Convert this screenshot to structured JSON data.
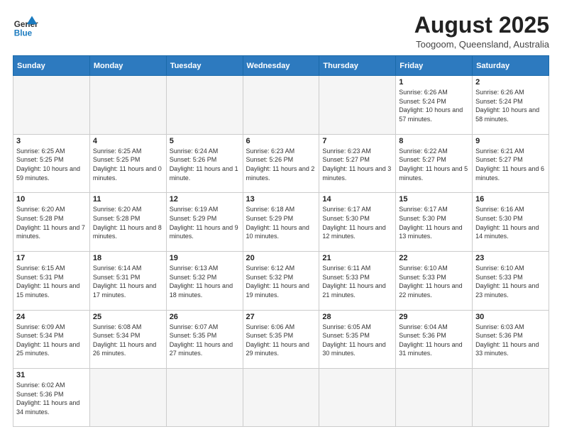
{
  "header": {
    "logo_general": "General",
    "logo_blue": "Blue",
    "month_title": "August 2025",
    "location": "Toogoom, Queensland, Australia"
  },
  "weekdays": [
    "Sunday",
    "Monday",
    "Tuesday",
    "Wednesday",
    "Thursday",
    "Friday",
    "Saturday"
  ],
  "weeks": [
    [
      {
        "day": "",
        "info": "",
        "empty": true
      },
      {
        "day": "",
        "info": "",
        "empty": true
      },
      {
        "day": "",
        "info": "",
        "empty": true
      },
      {
        "day": "",
        "info": "",
        "empty": true
      },
      {
        "day": "",
        "info": "",
        "empty": true
      },
      {
        "day": "1",
        "info": "Sunrise: 6:26 AM\nSunset: 5:24 PM\nDaylight: 10 hours\nand 57 minutes."
      },
      {
        "day": "2",
        "info": "Sunrise: 6:26 AM\nSunset: 5:24 PM\nDaylight: 10 hours\nand 58 minutes."
      }
    ],
    [
      {
        "day": "3",
        "info": "Sunrise: 6:25 AM\nSunset: 5:25 PM\nDaylight: 10 hours\nand 59 minutes."
      },
      {
        "day": "4",
        "info": "Sunrise: 6:25 AM\nSunset: 5:25 PM\nDaylight: 11 hours\nand 0 minutes."
      },
      {
        "day": "5",
        "info": "Sunrise: 6:24 AM\nSunset: 5:26 PM\nDaylight: 11 hours\nand 1 minute."
      },
      {
        "day": "6",
        "info": "Sunrise: 6:23 AM\nSunset: 5:26 PM\nDaylight: 11 hours\nand 2 minutes."
      },
      {
        "day": "7",
        "info": "Sunrise: 6:23 AM\nSunset: 5:27 PM\nDaylight: 11 hours\nand 3 minutes."
      },
      {
        "day": "8",
        "info": "Sunrise: 6:22 AM\nSunset: 5:27 PM\nDaylight: 11 hours\nand 5 minutes."
      },
      {
        "day": "9",
        "info": "Sunrise: 6:21 AM\nSunset: 5:27 PM\nDaylight: 11 hours\nand 6 minutes."
      }
    ],
    [
      {
        "day": "10",
        "info": "Sunrise: 6:20 AM\nSunset: 5:28 PM\nDaylight: 11 hours\nand 7 minutes."
      },
      {
        "day": "11",
        "info": "Sunrise: 6:20 AM\nSunset: 5:28 PM\nDaylight: 11 hours\nand 8 minutes."
      },
      {
        "day": "12",
        "info": "Sunrise: 6:19 AM\nSunset: 5:29 PM\nDaylight: 11 hours\nand 9 minutes."
      },
      {
        "day": "13",
        "info": "Sunrise: 6:18 AM\nSunset: 5:29 PM\nDaylight: 11 hours\nand 10 minutes."
      },
      {
        "day": "14",
        "info": "Sunrise: 6:17 AM\nSunset: 5:30 PM\nDaylight: 11 hours\nand 12 minutes."
      },
      {
        "day": "15",
        "info": "Sunrise: 6:17 AM\nSunset: 5:30 PM\nDaylight: 11 hours\nand 13 minutes."
      },
      {
        "day": "16",
        "info": "Sunrise: 6:16 AM\nSunset: 5:30 PM\nDaylight: 11 hours\nand 14 minutes."
      }
    ],
    [
      {
        "day": "17",
        "info": "Sunrise: 6:15 AM\nSunset: 5:31 PM\nDaylight: 11 hours\nand 15 minutes."
      },
      {
        "day": "18",
        "info": "Sunrise: 6:14 AM\nSunset: 5:31 PM\nDaylight: 11 hours\nand 17 minutes."
      },
      {
        "day": "19",
        "info": "Sunrise: 6:13 AM\nSunset: 5:32 PM\nDaylight: 11 hours\nand 18 minutes."
      },
      {
        "day": "20",
        "info": "Sunrise: 6:12 AM\nSunset: 5:32 PM\nDaylight: 11 hours\nand 19 minutes."
      },
      {
        "day": "21",
        "info": "Sunrise: 6:11 AM\nSunset: 5:33 PM\nDaylight: 11 hours\nand 21 minutes."
      },
      {
        "day": "22",
        "info": "Sunrise: 6:10 AM\nSunset: 5:33 PM\nDaylight: 11 hours\nand 22 minutes."
      },
      {
        "day": "23",
        "info": "Sunrise: 6:10 AM\nSunset: 5:33 PM\nDaylight: 11 hours\nand 23 minutes."
      }
    ],
    [
      {
        "day": "24",
        "info": "Sunrise: 6:09 AM\nSunset: 5:34 PM\nDaylight: 11 hours\nand 25 minutes."
      },
      {
        "day": "25",
        "info": "Sunrise: 6:08 AM\nSunset: 5:34 PM\nDaylight: 11 hours\nand 26 minutes."
      },
      {
        "day": "26",
        "info": "Sunrise: 6:07 AM\nSunset: 5:35 PM\nDaylight: 11 hours\nand 27 minutes."
      },
      {
        "day": "27",
        "info": "Sunrise: 6:06 AM\nSunset: 5:35 PM\nDaylight: 11 hours\nand 29 minutes."
      },
      {
        "day": "28",
        "info": "Sunrise: 6:05 AM\nSunset: 5:35 PM\nDaylight: 11 hours\nand 30 minutes."
      },
      {
        "day": "29",
        "info": "Sunrise: 6:04 AM\nSunset: 5:36 PM\nDaylight: 11 hours\nand 31 minutes."
      },
      {
        "day": "30",
        "info": "Sunrise: 6:03 AM\nSunset: 5:36 PM\nDaylight: 11 hours\nand 33 minutes."
      }
    ],
    [
      {
        "day": "31",
        "info": "Sunrise: 6:02 AM\nSunset: 5:36 PM\nDaylight: 11 hours\nand 34 minutes.",
        "last": true
      },
      {
        "day": "",
        "info": "",
        "empty": true,
        "last": true
      },
      {
        "day": "",
        "info": "",
        "empty": true,
        "last": true
      },
      {
        "day": "",
        "info": "",
        "empty": true,
        "last": true
      },
      {
        "day": "",
        "info": "",
        "empty": true,
        "last": true
      },
      {
        "day": "",
        "info": "",
        "empty": true,
        "last": true
      },
      {
        "day": "",
        "info": "",
        "empty": true,
        "last": true
      }
    ]
  ]
}
